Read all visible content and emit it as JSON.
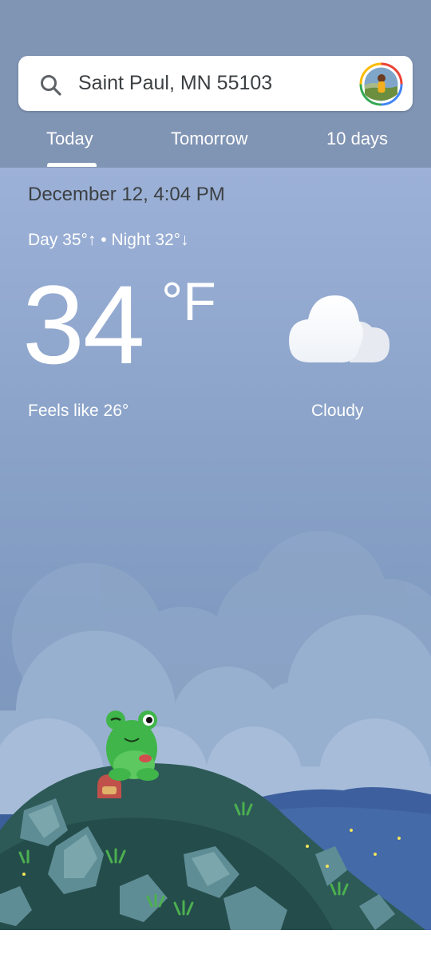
{
  "search": {
    "location": "Saint Paul, MN 55103"
  },
  "tabs": [
    {
      "label": "Today",
      "selected": true
    },
    {
      "label": "Tomorrow",
      "selected": false
    },
    {
      "label": "10 days",
      "selected": false
    }
  ],
  "weather": {
    "date_time": "December 12, 4:04 PM",
    "day_night": "Day 35°↑ • Night 32°↓",
    "temperature": "34",
    "unit": "°F",
    "feels_like": "Feels like 26°",
    "condition": "Cloudy",
    "condition_icon": "cloud-icon"
  },
  "colors": {
    "header_bg": "#8094b4",
    "sky_top": "#9cb1d8",
    "text_dark": "#3c4043",
    "text_light": "#ffffff"
  }
}
